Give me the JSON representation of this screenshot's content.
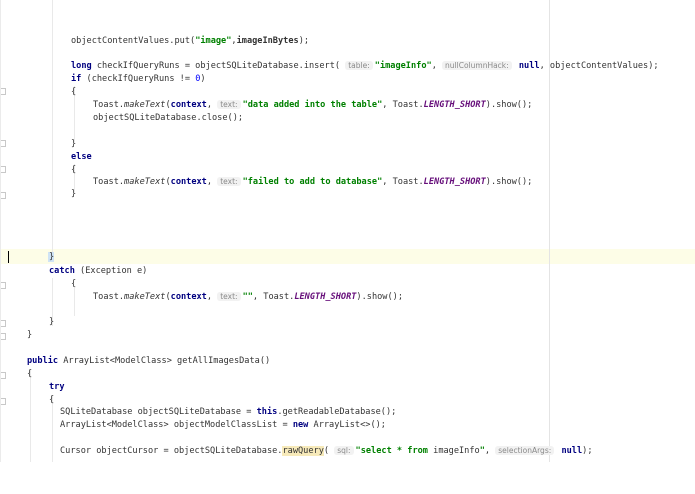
{
  "editor": {
    "lines": {
      "l1": {
        "a": "objectContentValues.put(",
        "b": "\"image\"",
        "c": ",",
        "d": "imageInBytes",
        "e": ");"
      },
      "l2": {
        "a": "long",
        "b": " checkIfQueryRuns = objectSQLiteDatabase.insert( ",
        "h1": "table:",
        "s1": "\"imageInfo\"",
        "c": ", ",
        "h2": "nullColumnHack:",
        "d": " null",
        "e": ", objectContentValues);"
      },
      "l3": {
        "a": "if",
        "b": " (checkIfQueryRuns != ",
        "n": "0",
        "e": ")"
      },
      "l4": {
        "a": "{"
      },
      "l5": {
        "a": "Toast.",
        "m": "makeText",
        "b": "(",
        "ctx": "context",
        "c": ", ",
        "h": "text:",
        "s": "\"data added into the table\"",
        "d": ", Toast.",
        "k": "LENGTH_SHORT",
        "e": ").show();"
      },
      "l6": {
        "a": "objectSQLiteDatabase.close();"
      },
      "l7": {
        "a": "}"
      },
      "l8": {
        "a": "else"
      },
      "l9": {
        "a": "{"
      },
      "l10": {
        "a": "Toast.",
        "m": "makeText",
        "b": "(",
        "ctx": "context",
        "c": ", ",
        "h": "text:",
        "s": "\"failed to add to database\"",
        "d": ", Toast.",
        "k": "LENGTH_SHORT",
        "e": ").show();"
      },
      "l11": {
        "a": "}"
      },
      "l12": {
        "a": "}"
      },
      "l13": {
        "a": "catch",
        "b": " (Exception e)"
      },
      "l14": {
        "a": "{"
      },
      "l15": {
        "a": "Toast.",
        "m": "makeText",
        "b": "(",
        "ctx": "context",
        "c": ", ",
        "h": "text:",
        "s": "\"\"",
        "d": ", Toast.",
        "k": "LENGTH_SHORT",
        "e": ").show();"
      },
      "l16": {
        "a": "}"
      },
      "l17": {
        "a": "}"
      },
      "l18": {
        "a": "public",
        "b": " ArrayList<ModelClass> getAllImagesData()"
      },
      "l19": {
        "a": "{"
      },
      "l20": {
        "a": "try"
      },
      "l21": {
        "a": "{"
      },
      "l22": {
        "a": "SQLiteDatabase objectSQLiteDatabase = ",
        "k": "this",
        "b": ".getReadableDatabase();"
      },
      "l23": {
        "a": "ArrayList<ModelClass> objectModelClassList = ",
        "k": "new",
        "b": " ArrayList<>();"
      },
      "l24": {
        "a": "Cursor objectCursor = objectSQLiteDatabase.",
        "r": "rawQuery",
        "b": "( ",
        "h1": "sql:",
        "s": "\"select * from ",
        "t": "imageInfo",
        "s2": "\"",
        "c": ", ",
        "h2": "selectionArgs:",
        "d": " null",
        "e": ");"
      }
    }
  },
  "colors": {
    "keyword": "#000080",
    "string": "#008000",
    "static_field": "#660e7a",
    "number": "#0000ff",
    "current_line": "#fdfde7"
  }
}
